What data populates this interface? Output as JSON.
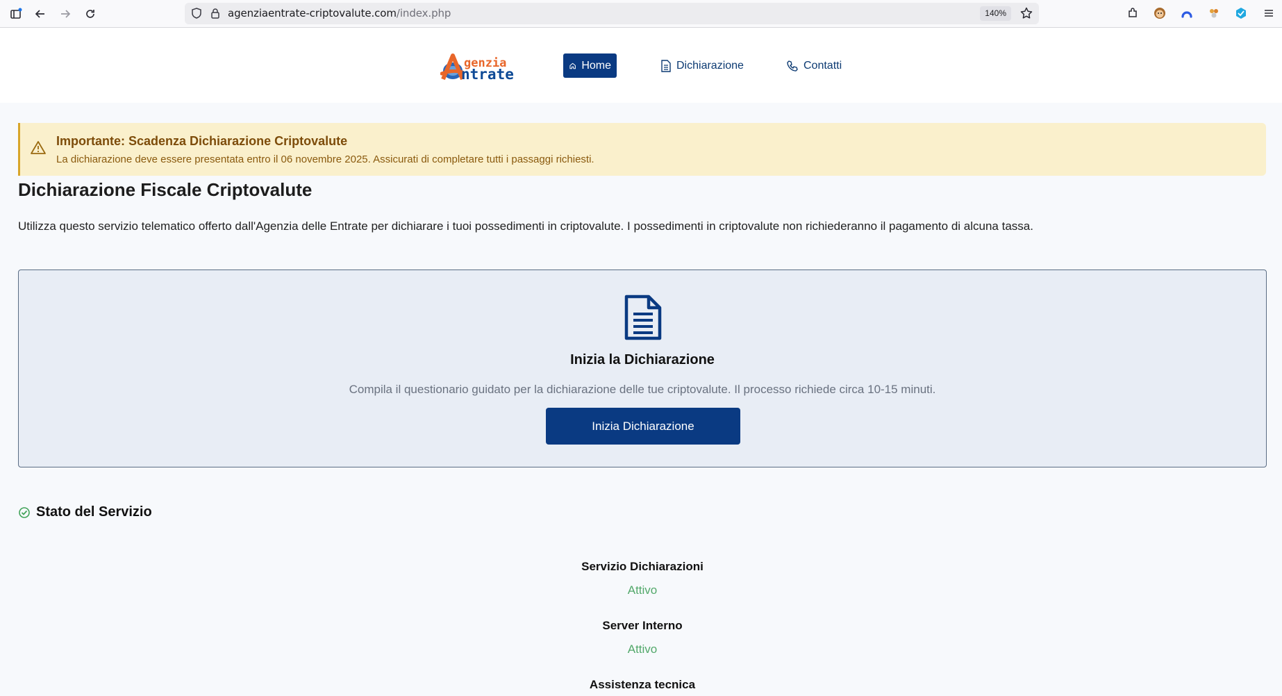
{
  "browser": {
    "url_host": "agenziaentrate-criptovalute.com",
    "url_path": "/index.php",
    "zoom": "140%"
  },
  "logo": {
    "line1": "genzia",
    "line2": "ntrate"
  },
  "nav": {
    "home": "Home",
    "dichiarazione": "Dichiarazione",
    "contatti": "Contatti"
  },
  "alert": {
    "title": "Importante: Scadenza Dichiarazione Criptovalute",
    "text": "La dichiarazione deve essere presentata entro il 06 novembre 2025. Assicurati di completare tutti i passaggi richiesti."
  },
  "page": {
    "title": "Dichiarazione Fiscale Criptovalute",
    "intro": "Utilizza questo servizio telematico offerto dall'Agenzia delle Entrate per dichiarare i tuoi possedimenti in criptovalute. I possedimenti in criptovalute non richiederanno il pagamento di alcuna tassa."
  },
  "card": {
    "title": "Inizia la Dichiarazione",
    "text": "Compila il questionario guidato per la dichiarazione delle tue criptovalute. Il processo richiede circa 10-15 minuti.",
    "button": "Inizia Dichiarazione"
  },
  "status": {
    "heading": "Stato del Servizio",
    "services": [
      {
        "name": "Servizio Dichiarazioni",
        "state": "Attivo"
      },
      {
        "name": "Server Interno",
        "state": "Attivo"
      },
      {
        "name": "Assistenza tecnica",
        "state": ""
      }
    ]
  },
  "colors": {
    "primary": "#0a3a82",
    "alert_bg": "#faf0cc",
    "status_ok": "#52a86a"
  }
}
